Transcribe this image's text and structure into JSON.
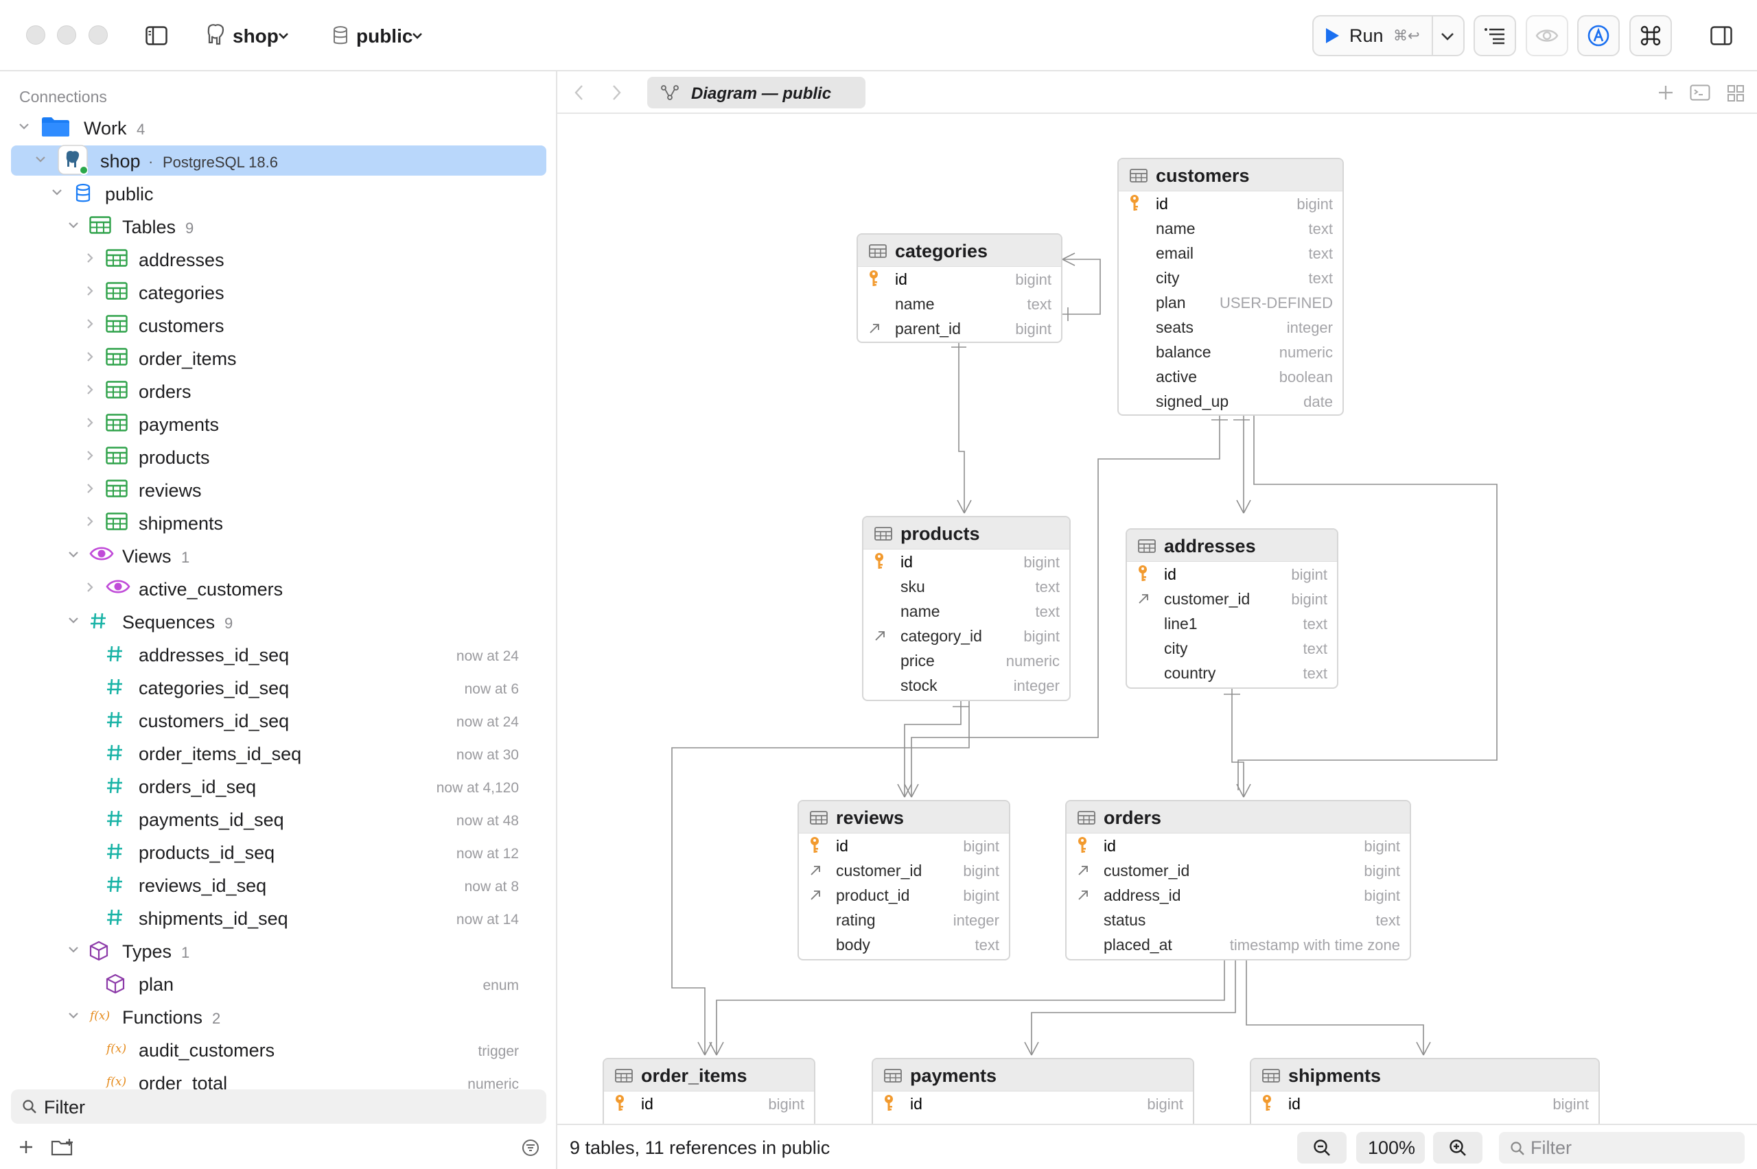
{
  "toolbar": {
    "connection_label": "shop",
    "schema_label": "public",
    "run_label": "Run",
    "run_shortcut": "⌘↩"
  },
  "sidebar": {
    "heading": "Connections",
    "group": {
      "label": "Work",
      "count": "4"
    },
    "connection": {
      "label": "shop",
      "separator": "·",
      "engine": "PostgreSQL 18.6"
    },
    "schema": {
      "label": "public"
    },
    "tables": {
      "label": "Tables",
      "count": "9",
      "items": [
        "addresses",
        "categories",
        "customers",
        "order_items",
        "orders",
        "payments",
        "products",
        "reviews",
        "shipments"
      ]
    },
    "views": {
      "label": "Views",
      "count": "1",
      "items": [
        "active_customers"
      ]
    },
    "sequences": {
      "label": "Sequences",
      "count": "9",
      "items": [
        {
          "name": "addresses_id_seq",
          "meta": "now at 24"
        },
        {
          "name": "categories_id_seq",
          "meta": "now at 6"
        },
        {
          "name": "customers_id_seq",
          "meta": "now at 24"
        },
        {
          "name": "order_items_id_seq",
          "meta": "now at 30"
        },
        {
          "name": "orders_id_seq",
          "meta": "now at 4,120"
        },
        {
          "name": "payments_id_seq",
          "meta": "now at 48"
        },
        {
          "name": "products_id_seq",
          "meta": "now at 12"
        },
        {
          "name": "reviews_id_seq",
          "meta": "now at 8"
        },
        {
          "name": "shipments_id_seq",
          "meta": "now at 14"
        }
      ]
    },
    "types": {
      "label": "Types",
      "count": "1",
      "items": [
        {
          "name": "plan",
          "meta": "enum"
        }
      ]
    },
    "functions": {
      "label": "Functions",
      "count": "2",
      "items": [
        {
          "name": "audit_customers",
          "meta": "trigger"
        },
        {
          "name": "order_total",
          "meta": "numeric"
        }
      ]
    },
    "filter_placeholder": "Filter"
  },
  "tab": {
    "label": "Diagram — public"
  },
  "diagram": {
    "tables": [
      {
        "name": "customers",
        "columns": [
          {
            "name": "id",
            "type": "bigint",
            "key": "pk"
          },
          {
            "name": "name",
            "type": "text",
            "key": ""
          },
          {
            "name": "email",
            "type": "text",
            "key": ""
          },
          {
            "name": "city",
            "type": "text",
            "key": ""
          },
          {
            "name": "plan",
            "type": "USER-DEFINED",
            "key": ""
          },
          {
            "name": "seats",
            "type": "integer",
            "key": ""
          },
          {
            "name": "balance",
            "type": "numeric",
            "key": ""
          },
          {
            "name": "active",
            "type": "boolean",
            "key": ""
          },
          {
            "name": "signed_up",
            "type": "date",
            "key": ""
          }
        ]
      },
      {
        "name": "categories",
        "columns": [
          {
            "name": "id",
            "type": "bigint",
            "key": "pk"
          },
          {
            "name": "name",
            "type": "text",
            "key": ""
          },
          {
            "name": "parent_id",
            "type": "bigint",
            "key": "fk"
          }
        ]
      },
      {
        "name": "products",
        "columns": [
          {
            "name": "id",
            "type": "bigint",
            "key": "pk"
          },
          {
            "name": "sku",
            "type": "text",
            "key": ""
          },
          {
            "name": "name",
            "type": "text",
            "key": ""
          },
          {
            "name": "category_id",
            "type": "bigint",
            "key": "fk"
          },
          {
            "name": "price",
            "type": "numeric",
            "key": ""
          },
          {
            "name": "stock",
            "type": "integer",
            "key": ""
          }
        ]
      },
      {
        "name": "addresses",
        "columns": [
          {
            "name": "id",
            "type": "bigint",
            "key": "pk"
          },
          {
            "name": "customer_id",
            "type": "bigint",
            "key": "fk"
          },
          {
            "name": "line1",
            "type": "text",
            "key": ""
          },
          {
            "name": "city",
            "type": "text",
            "key": ""
          },
          {
            "name": "country",
            "type": "text",
            "key": ""
          }
        ]
      },
      {
        "name": "reviews",
        "columns": [
          {
            "name": "id",
            "type": "bigint",
            "key": "pk"
          },
          {
            "name": "customer_id",
            "type": "bigint",
            "key": "fk"
          },
          {
            "name": "product_id",
            "type": "bigint",
            "key": "fk"
          },
          {
            "name": "rating",
            "type": "integer",
            "key": ""
          },
          {
            "name": "body",
            "type": "text",
            "key": ""
          }
        ]
      },
      {
        "name": "orders",
        "columns": [
          {
            "name": "id",
            "type": "bigint",
            "key": "pk"
          },
          {
            "name": "customer_id",
            "type": "bigint",
            "key": "fk"
          },
          {
            "name": "address_id",
            "type": "bigint",
            "key": "fk"
          },
          {
            "name": "status",
            "type": "text",
            "key": ""
          },
          {
            "name": "placed_at",
            "type": "timestamp with time zone",
            "key": ""
          }
        ]
      },
      {
        "name": "order_items",
        "columns": [
          {
            "name": "id",
            "type": "bigint",
            "key": "pk"
          }
        ]
      },
      {
        "name": "payments",
        "columns": [
          {
            "name": "id",
            "type": "bigint",
            "key": "pk"
          }
        ]
      },
      {
        "name": "shipments",
        "columns": [
          {
            "name": "id",
            "type": "bigint",
            "key": "pk"
          }
        ]
      }
    ]
  },
  "status": {
    "summary": "9 tables, 11 references in public",
    "zoom": "100%",
    "filter_placeholder": "Filter"
  },
  "colors": {
    "selection": "#b9d7fb",
    "folder": "#1a7cf5",
    "table_icon": "#2fa24a",
    "view_icon": "#c04bd8",
    "sequence_icon": "#19b3a6",
    "type_icon": "#8c3aa8",
    "function_icon": "#e58a1b",
    "pk_icon": "#f29a2e",
    "accent": "#1a6ff0"
  }
}
